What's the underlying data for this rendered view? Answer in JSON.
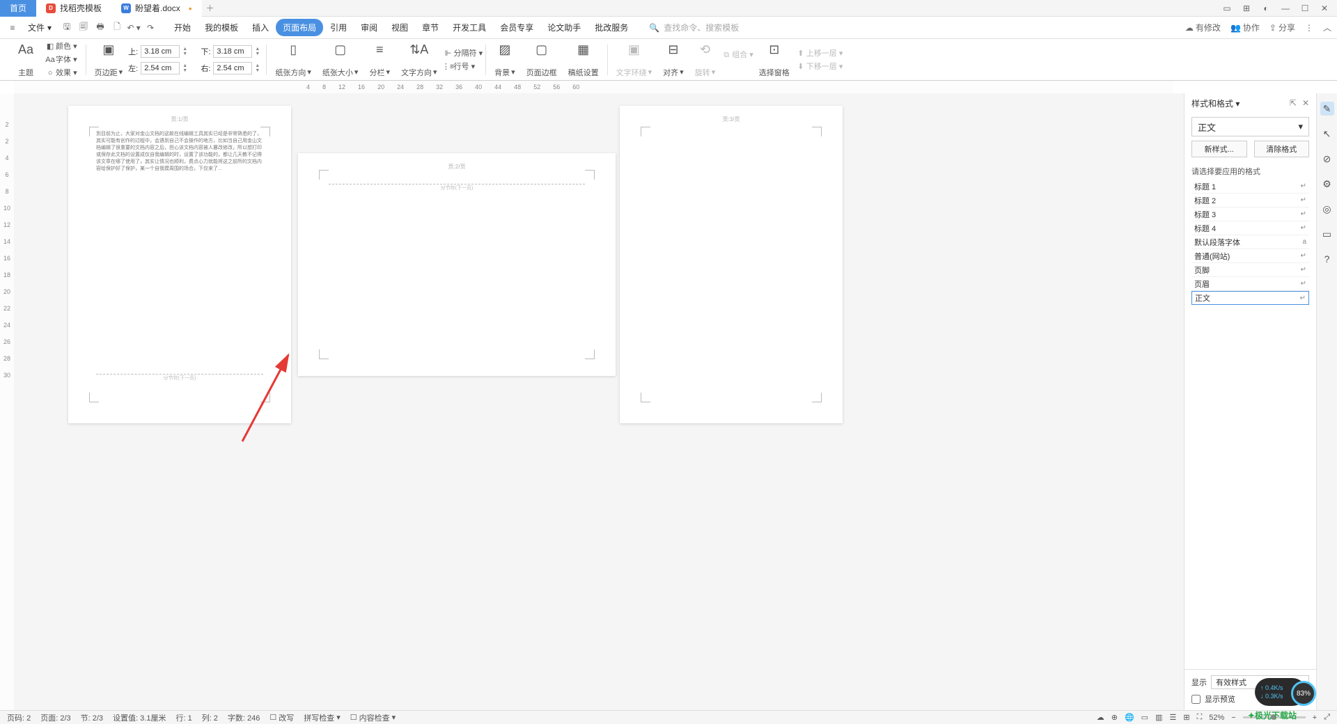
{
  "titlebar": {
    "tabs": [
      {
        "label": "首页"
      },
      {
        "label": "找稻壳模板",
        "icon": "D"
      },
      {
        "label": "盼望着.docx",
        "icon": "W"
      }
    ],
    "unsaved": "•"
  },
  "menubar": {
    "file": "文件",
    "tabs": [
      "开始",
      "我的模板",
      "插入",
      "页面布局",
      "引用",
      "审阅",
      "视图",
      "章节",
      "开发工具",
      "会员专享",
      "论文助手",
      "批改服务"
    ],
    "active_index": 3,
    "search_placeholder": "查找命令、搜索模板"
  },
  "menu_right": {
    "changes": "有修改",
    "collab": "协作",
    "share": "分享"
  },
  "ribbon": {
    "theme": "主题",
    "font": "字体",
    "effect": "效果",
    "color": "颜色",
    "margins_label": "页边距",
    "margin_top": {
      "icon": "上:",
      "val": "3.18 cm"
    },
    "margin_bottom": {
      "icon": "下:",
      "val": "3.18 cm"
    },
    "margin_left": {
      "icon": "左:",
      "val": "2.54 cm"
    },
    "margin_right": {
      "icon": "右:",
      "val": "2.54 cm"
    },
    "paper_dir": "纸张方向",
    "paper_size": "纸张大小",
    "columns": "分栏",
    "text_dir": "文字方向",
    "line_no": "行号",
    "breaks": "分隔符",
    "bg": "背景",
    "page_border": "页面边框",
    "paper_set": "稿纸设置",
    "wrap": "文字环绕",
    "align": "对齐",
    "rotate": "旋转",
    "group_btn": "组合",
    "sel_pane": "选择窗格",
    "up": "上移一层",
    "down": "下移一层"
  },
  "hruler": [
    "4",
    "8",
    "12",
    "16",
    "20",
    "24",
    "28",
    "32",
    "36",
    "40",
    "44",
    "48",
    "52",
    "56",
    "60"
  ],
  "vruler": [
    "2",
    "2",
    "4",
    "6",
    "8",
    "10",
    "12",
    "14",
    "16",
    "18",
    "20",
    "22",
    "24",
    "26",
    "28",
    "30"
  ],
  "pages": {
    "hdr1": "页:1/页",
    "hdr2": "页:2/页",
    "hdr3": "页:3/页",
    "body1": "到目前为止，大家对金山文档的这款在线编辑工具其实已经是非常熟悉的了，其实可能有创作的过程中，会遇到自己不会操作的地方，比如当自己用金山文档编辑了很重要的文档内容之后，担心该文档内容被人篡改修改，所以想打印或保存此文档的设置成仅自我编辑的时，设置了该功能的，都让几天教不记得该文章在哪了使用了，其实让情况也顺利，费点心力就能将这之前所的文档内容给保护好了保护，某一个自我摸周围的场合，下仅来了...",
    "break": "分节符(下一页)"
  },
  "rpanel": {
    "title": "样式和格式",
    "current": "正文",
    "btn_new": "新样式...",
    "btn_clear": "清除格式",
    "section": "请选择要应用的格式",
    "items": [
      {
        "label": "标题 1",
        "g": "↵"
      },
      {
        "label": "标题 2",
        "g": "↵"
      },
      {
        "label": "标题 3",
        "g": "↵"
      },
      {
        "label": "标题 4",
        "g": "↵"
      },
      {
        "label": "默认段落字体",
        "g": "a"
      },
      {
        "label": "普通(网站)",
        "g": "↵"
      },
      {
        "label": "页脚",
        "g": "↵"
      },
      {
        "label": "页眉",
        "g": "↵"
      },
      {
        "label": "正文",
        "g": "↵",
        "selected": true
      }
    ],
    "show_label": "显示",
    "show_value": "有效样式",
    "preview": "显示预览"
  },
  "status": {
    "page": "页码: 2",
    "pages": "页面: 2/3",
    "sect": "节: 2/3",
    "setting": "设置值: 3.1厘米",
    "row": "行: 1",
    "col": "列: 2",
    "words": "字数: 246",
    "changes": "改写",
    "spell": "拼写检查",
    "content": "内容检查",
    "zoom": "52%"
  },
  "float": {
    "up": "0.4K/s",
    "down": "0.3K/s",
    "pct": "83%",
    "logo": "极光下载站"
  }
}
